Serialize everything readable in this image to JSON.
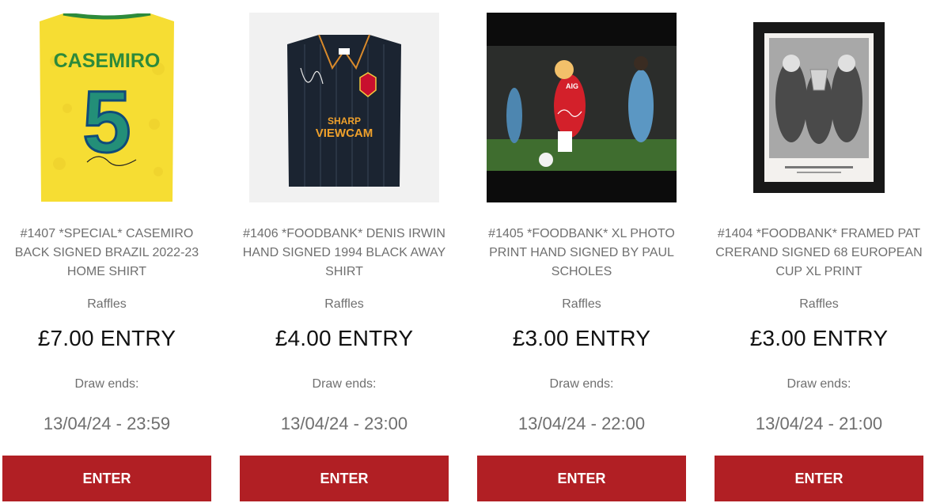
{
  "products": [
    {
      "title": "#1407 *SPECIAL* CASEMIRO BACK SIGNED BRAZIL 2022-23 HOME SHIRT",
      "category": "Raffles",
      "price": "£7.00 ENTRY",
      "draw_label": "Draw ends:",
      "draw_date": "13/04/24 - 23:59",
      "button_label": "ENTER",
      "image": {
        "name_text": "CASEMIRO",
        "number_text": "5"
      }
    },
    {
      "title": "#1406 *FOODBANK* DENIS IRWIN HAND SIGNED 1994 BLACK AWAY SHIRT",
      "category": "Raffles",
      "price": "£4.00 ENTRY",
      "draw_label": "Draw ends:",
      "draw_date": "13/04/24 - 23:00",
      "button_label": "ENTER",
      "image": {
        "sponsor_line1": "SHARP",
        "sponsor_line2": "VIEWCAM"
      }
    },
    {
      "title": "#1405 *FOODBANK* XL PHOTO PRINT HAND SIGNED BY PAUL SCHOLES",
      "category": "Raffles",
      "price": "£3.00 ENTRY",
      "draw_label": "Draw ends:",
      "draw_date": "13/04/24 - 22:00",
      "button_label": "ENTER",
      "image": {
        "kit_text": "AIG"
      }
    },
    {
      "title": "#1404 *FOODBANK* FRAMED PAT CRERAND SIGNED 68 EUROPEAN CUP XL PRINT",
      "category": "Raffles",
      "price": "£3.00 ENTRY",
      "draw_label": "Draw ends:",
      "draw_date": "13/04/24 - 21:00",
      "button_label": "ENTER",
      "image": {}
    }
  ],
  "colors": {
    "button_bg": "#b11f24",
    "button_text": "#ffffff",
    "muted_text": "#6f6f6f",
    "price_text": "#111111"
  }
}
